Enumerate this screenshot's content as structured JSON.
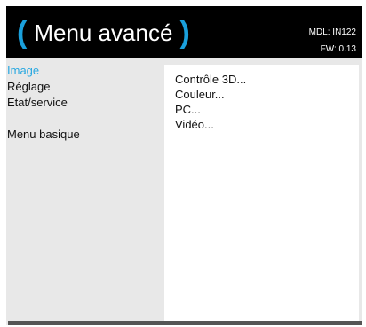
{
  "header": {
    "open_paren": "(",
    "title": "Menu avancé",
    "close_paren": ")",
    "model": "MDL: IN122",
    "firmware": "FW: 0.13"
  },
  "left_menu": {
    "items": [
      {
        "label": "Image",
        "active": true
      },
      {
        "label": "Réglage",
        "active": false
      },
      {
        "label": "Etat/service",
        "active": false
      }
    ],
    "basic_menu_label": "Menu basique"
  },
  "submenu": {
    "items": [
      {
        "label": "Contrôle 3D..."
      },
      {
        "label": "Couleur..."
      },
      {
        "label": "PC..."
      },
      {
        "label": "Vidéo..."
      }
    ]
  },
  "colors": {
    "accent": "#29a8e0",
    "header_bg": "#000000",
    "frame_bg": "#e8e8e8",
    "panel_bg": "#ffffff"
  }
}
